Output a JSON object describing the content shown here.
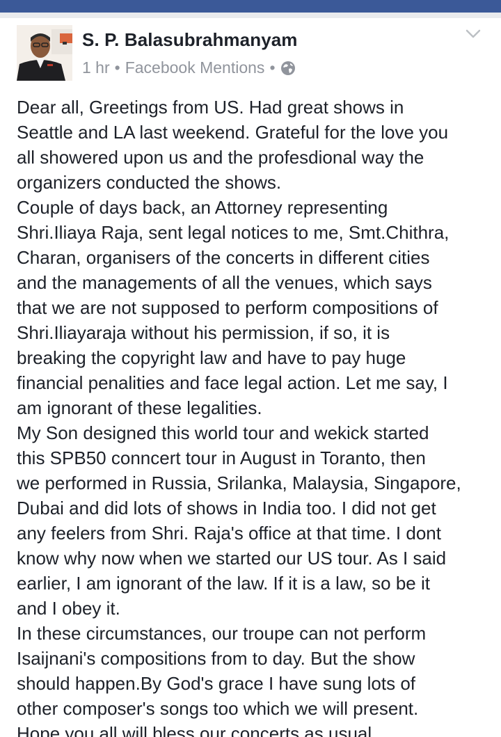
{
  "post": {
    "author": "S. P. Balasubrahmanyam",
    "time": "1 hr",
    "separator": "•",
    "source": "Facebook Mentions",
    "privacy_icon": "globe-icon",
    "menu_icon": "chevron-down-icon",
    "lines": [
      "Dear all, Greetings from US. Had great shows in",
      "Seattle and LA last weekend. Grateful for the love you",
      "all showered upon us and the profesdional way the",
      "organizers conducted the shows.",
      "Couple of days back, an Attorney representing",
      "Shri.Iliaya Raja, sent legal notices  to me, Smt.Chithra,",
      "Charan, organisers of the concerts in different cities",
      "and the managements of all the venues, which says",
      "that we are not supposed to perform compositions of",
      "Shri.Iliayaraja without his permission, if so, it is",
      "breaking the copyright law and have to pay huge",
      "financial penalities and face legal action. Let me say, I",
      "am ignorant of these legalities.",
      "My Son designed this world tour and wekick started",
      "this SPB50 conncert tour in August in Toranto, then",
      "we performed in Russia, Srilanka, Malaysia, Singapore,",
      "Dubai and did lots of shows in India too. I did not get",
      "any feelers from Shri. Raja's office at that time. I dont",
      "know why now when we started our US tour. As I said",
      "earlier, I am ignorant of the law. If it is a law, so be it",
      "and I obey it.",
      "In these circumstances, our troupe can not perform",
      "Isaijnani's compositions from to day. But the show",
      "should happen.By God's grace I have sung lots of",
      "other composer's songs too which we will present.",
      "Hope you all will bless our concerts as usual."
    ]
  },
  "colors": {
    "header_blue": "#3b5998",
    "text": "#1d2129",
    "meta": "#90949c"
  }
}
